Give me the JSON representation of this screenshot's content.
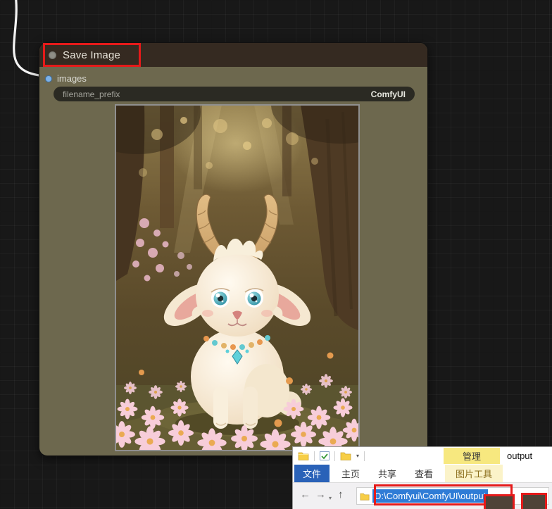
{
  "node": {
    "title": "Save Image",
    "input_label": "images",
    "widget_label": "filename_prefix",
    "widget_value": "ComfyUI",
    "body_color": "#6d684e",
    "title_bar_color": "#352a21",
    "input_type_color": "#7db2e8"
  },
  "annotation": {
    "highlight_color": "#e51a1a"
  },
  "explorer": {
    "window_title": "output",
    "manage_tab": "管理",
    "tab_file": "文件",
    "tab_home": "主页",
    "tab_share": "共享",
    "tab_view": "查看",
    "tab_picture_tools": "图片工具",
    "address": "D:\\Comfyui\\ComfyUI\\output",
    "address_selection_color": "#2f7cd6",
    "icons": {
      "back": "←",
      "forward": "→",
      "up": "↑",
      "history_dropdown": "▾",
      "qat_dropdown": "▾"
    }
  }
}
